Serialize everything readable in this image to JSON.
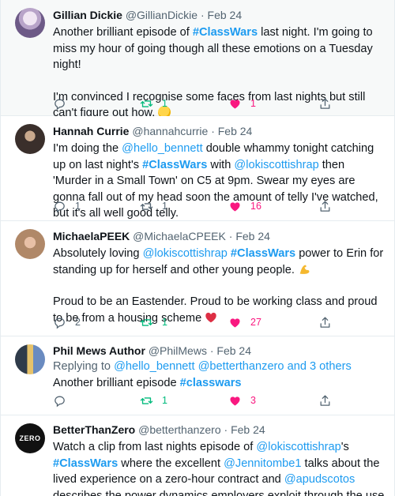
{
  "tweets": [
    {
      "name": "Gillian Dickie",
      "handle": "@GillianDickie",
      "dot": "·",
      "date": "Feb 24",
      "p1": {
        "t1": "Another brilliant episode of ",
        "tag1": "#ClassWars",
        "t2": " last night. I'm going to miss my hour of going though all these emotions on a Tuesday night!"
      },
      "p2": {
        "t1": "I'm convinced I recognise some faces from last nights but still can't figure out how. "
      },
      "emoji": "thinking-face",
      "replies": "",
      "retweets": "1",
      "likes": "1",
      "liked": true,
      "retweeted": true
    },
    {
      "name": "Hannah Currie",
      "handle": "@hannahcurrie",
      "dot": "·",
      "date": "Feb 24",
      "p1": {
        "t1": "I'm doing the ",
        "link1": "@hello_bennett",
        "t2": " double whammy tonight catching up on last night's ",
        "tag1": "#ClassWars",
        "t3": " with ",
        "link2": "@lokiscottishrap",
        "t4": " then 'Murder in a Small Town' on C5  at 9pm. Swear my eyes are gonna fall out of my head soon the amount of telly I've watched, but it's all well good telly."
      },
      "replies": "1",
      "retweets": "1",
      "likes": "16",
      "liked": true,
      "retweeted": false
    },
    {
      "name": "MichaelaPEEK",
      "handle": "@MichaelaCPEEK",
      "dot": "·",
      "date": "Feb 24",
      "p1": {
        "t1": "Absolutely loving ",
        "link1": "@lokiscottishrap",
        "t2": " ",
        "tag1": "#ClassWars",
        "t3": " power to Erin for standing up for herself and other young people. "
      },
      "p2": {
        "t1": "Proud to be an Eastender. Proud to be working class and proud to be from a housing scheme "
      },
      "emoji1": "flexed-biceps",
      "emoji2": "red-heart",
      "replies": "2",
      "retweets": "1",
      "likes": "27",
      "liked": true,
      "retweeted": true
    },
    {
      "name": "Phil Mews Author",
      "handle": "@PhilMews",
      "dot": "·",
      "date": "Feb 24",
      "replying": {
        "t1": "Replying to ",
        "link1": "@hello_bennett",
        "t2": " ",
        "link2": "@betterthanzero",
        "t3": " and 3 others"
      },
      "p1": {
        "t1": "Another brilliant episode ",
        "tag1": "#classwars"
      },
      "replies": "",
      "retweets": "1",
      "likes": "3",
      "liked": true,
      "retweeted": true
    },
    {
      "name": "BetterThanZero",
      "handle": "@betterthanzero",
      "dot": "·",
      "date": "Feb 24",
      "avatar_text": "ZERO",
      "p1": {
        "t1": "Watch a clip from last nights episode of ",
        "link1": "@lokiscottishrap",
        "t2": "'s ",
        "tag1": "#ClassWars",
        "t3": " where the excellent ",
        "link2": "@Jennitombe1",
        "t4": " talks about the lived experience on a zero-hour contract and ",
        "link3": "@apudscotos",
        "t5": " describes the power dynamics employers exploit through the use of precarious employment practices."
      }
    }
  ],
  "colors": {
    "accent": "#1d9bf0",
    "retweet": "#00ba7c",
    "like": "#f91880",
    "muted": "#536471"
  },
  "icons": {
    "reply": "reply-icon",
    "retweet": "retweet-icon",
    "like": "heart-icon",
    "share": "share-icon"
  }
}
